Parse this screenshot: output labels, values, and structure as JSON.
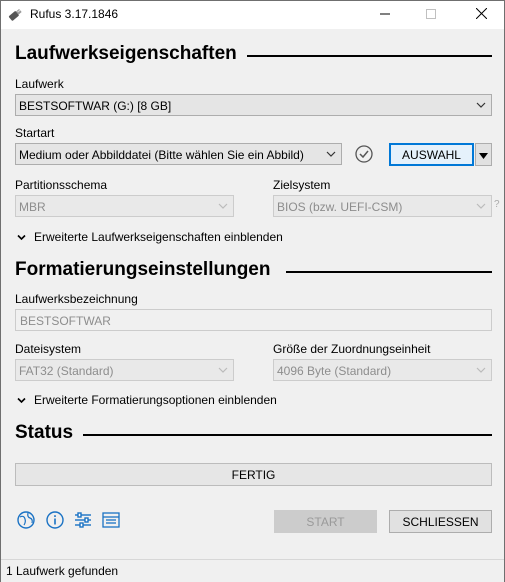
{
  "window": {
    "title": "Rufus 3.17.1846",
    "icon": "usb-drive-icon",
    "controls": [
      "minimize-icon",
      "maximize-icon",
      "close-icon"
    ]
  },
  "drive_section": {
    "heading": "Laufwerkseigenschaften",
    "device_label": "Laufwerk",
    "device_value": "BESTSOFTWAR (G:) [8 GB]",
    "boot_label": "Startart",
    "boot_value": "Medium oder Abbilddatei (Bitte wählen Sie ein Abbild)",
    "select_button": "AUSWAHL",
    "partition_label": "Partitionsschema",
    "partition_value": "MBR",
    "target_label": "Zielsystem",
    "target_value": "BIOS (bzw. UEFI-CSM)",
    "help_mark": "?",
    "advanced": "Erweiterte Laufwerkseigenschaften einblenden"
  },
  "format_section": {
    "heading": "Formatierungseinstellungen",
    "volume_label": "Laufwerksbezeichnung",
    "volume_value": "BESTSOFTWAR",
    "fs_label": "Dateisystem",
    "fs_value": "FAT32 (Standard)",
    "cluster_label": "Größe der Zuordnungseinheit",
    "cluster_value": "4096 Byte (Standard)",
    "advanced": "Erweiterte Formatierungsoptionen einblenden"
  },
  "status_section": {
    "heading": "Status",
    "progress_text": "FERTIG",
    "progress_fraction": 1.0
  },
  "toolbar": {
    "icons": [
      "globe-icon",
      "info-icon",
      "settings-sliders-icon",
      "log-icon"
    ],
    "start_button": "START",
    "close_button": "SCHLIESSEN"
  },
  "statusbar": {
    "text": "1 Laufwerk gefunden"
  },
  "colors": {
    "accent_icon": "#1a72c4",
    "check_icon": "#555555"
  }
}
